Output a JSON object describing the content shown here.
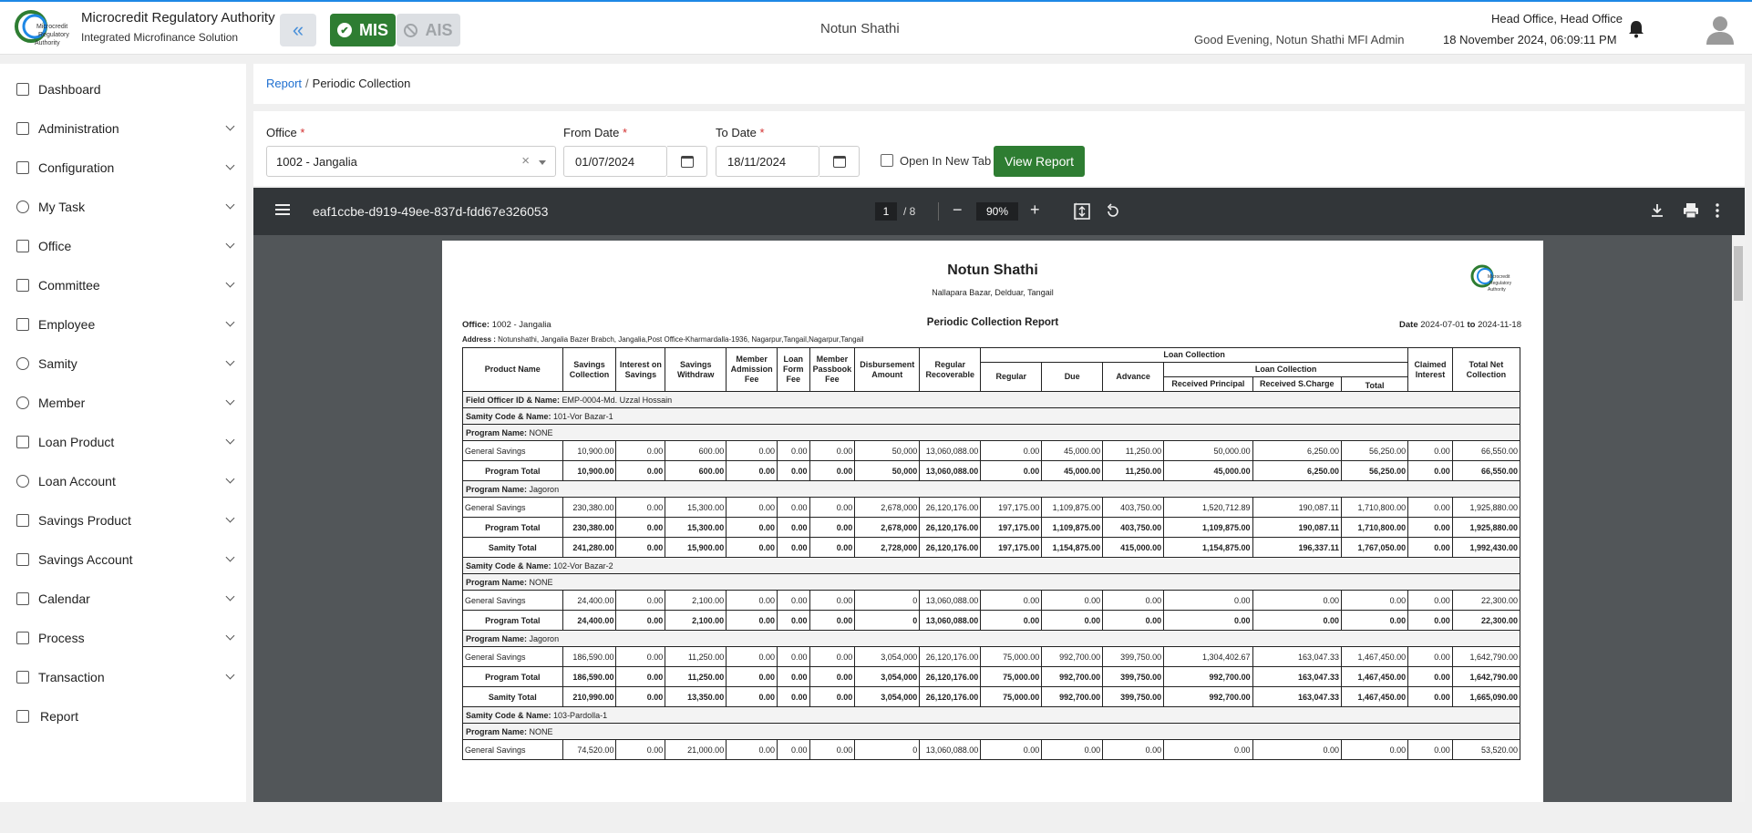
{
  "app": {
    "org_name": "Microcredit Regulatory Authority",
    "org_sub": "Integrated Microfinance Solution",
    "mis_label": "MIS",
    "ais_label": "AIS",
    "center_title": "Notun Shathi",
    "greeting": "Good Evening, Notun Shathi MFI Admin",
    "branch": "Head Office, Head Office",
    "datetime": "18 November 2024, 06:09:11 PM",
    "logo_text": "Microcredit Regulatory Authority"
  },
  "sidebar": {
    "items": [
      {
        "label": "Dashboard",
        "icon": "dashboard-icon"
      },
      {
        "label": "Administration",
        "icon": "admin-icon"
      },
      {
        "label": "Configuration",
        "icon": "sliders-icon"
      },
      {
        "label": "My Task",
        "icon": "task-icon"
      },
      {
        "label": "Office",
        "icon": "office-icon"
      },
      {
        "label": "Committee",
        "icon": "committee-icon"
      },
      {
        "label": "Employee",
        "icon": "employee-icon"
      },
      {
        "label": "Samity",
        "icon": "samity-icon"
      },
      {
        "label": "Member",
        "icon": "member-icon"
      },
      {
        "label": "Loan Product",
        "icon": "loan-product-icon"
      },
      {
        "label": "Loan Account",
        "icon": "loan-account-icon"
      },
      {
        "label": "Savings Product",
        "icon": "savings-product-icon"
      },
      {
        "label": "Savings Account",
        "icon": "savings-account-icon"
      },
      {
        "label": "Calendar",
        "icon": "calendar-icon"
      },
      {
        "label": "Process",
        "icon": "process-icon"
      },
      {
        "label": "Transaction",
        "icon": "transaction-icon"
      },
      {
        "label": "Report",
        "icon": "report-icon"
      }
    ]
  },
  "breadcrumb": {
    "root": "Report",
    "sep": "/",
    "current": "Periodic Collection"
  },
  "filters": {
    "office_label": "Office",
    "office_value": "1002 - Jangalia",
    "from_label": "From Date",
    "from_value": "01/07/2024",
    "to_label": "To Date",
    "to_value": "18/11/2024",
    "req": "*",
    "open_new_tab": "Open In New Tab",
    "view_report": "View Report"
  },
  "pdf": {
    "file_name": "eaf1ccbe-d919-49ee-837d-fdd67e326053",
    "page": "1",
    "page_total": "/ 8",
    "zoom": "90%"
  },
  "report": {
    "title": "Notun Shathi",
    "address_line": "Nallapara Bazar, Delduar, Tangail",
    "heading": "Periodic Collection Report",
    "office_label": "Office:",
    "office_value": "1002 - Jangalia",
    "address_label": "Address :",
    "address_value": "Notunshathi, Jangalia Bazer Brabch, Jangalia,Post Office-Kharmardalla-1936, Nagarpur,Tangail,Nagarpur,Tangail",
    "date_label": "Date",
    "date_from": "2024-07-01",
    "date_to_word": "to",
    "date_to": "2024-11-18",
    "headers": {
      "product_name": "Product Name",
      "savings_collection": "Savings Collection",
      "interest_on_savings": "Interest on Savings",
      "savings_withdraw": "Savings Withdraw",
      "member_admission_fee": "Member Admission Fee",
      "loan_form_fee": "Loan Form Fee",
      "member_passbook_fee": "Member Passbook Fee",
      "disbursement_amount": "Disbursement Amount",
      "regular_recoverable": "Regular Recoverable",
      "loan_collection": "Loan Collection",
      "regular": "Regular",
      "due": "Due",
      "advance": "Advance",
      "loan_collection_sub": "Loan Collection",
      "received_principal": "Received Principal",
      "received_scharge": "Received S.Charge",
      "total": "Total",
      "claimed_interest": "Claimed Interest",
      "total_net_collection": "Total Net Collection"
    },
    "rows": [
      {
        "kind": "sec",
        "label": "Field Officer ID & Name:",
        "value": "EMP-0004-Md. Uzzal Hossain"
      },
      {
        "kind": "sec",
        "label": "Samity Code & Name:",
        "value": "101-Vor Bazar-1"
      },
      {
        "kind": "sec",
        "label": "Program Name:",
        "value": "NONE"
      },
      {
        "kind": "data",
        "cells": [
          "General Savings",
          "10,900.00",
          "0.00",
          "600.00",
          "0.00",
          "0.00",
          "0.00",
          "50,000",
          "13,060,088.00",
          "0.00",
          "45,000.00",
          "11,250.00",
          "50,000.00",
          "6,250.00",
          "56,250.00",
          "0.00",
          "66,550.00"
        ]
      },
      {
        "kind": "tot",
        "cells": [
          "Program Total",
          "10,900.00",
          "0.00",
          "600.00",
          "0.00",
          "0.00",
          "0.00",
          "50,000",
          "13,060,088.00",
          "0.00",
          "45,000.00",
          "11,250.00",
          "45,000.00",
          "6,250.00",
          "56,250.00",
          "0.00",
          "66,550.00"
        ]
      },
      {
        "kind": "sec",
        "label": "Program Name:",
        "value": "Jagoron"
      },
      {
        "kind": "data",
        "cells": [
          "General Savings",
          "230,380.00",
          "0.00",
          "15,300.00",
          "0.00",
          "0.00",
          "0.00",
          "2,678,000",
          "26,120,176.00",
          "197,175.00",
          "1,109,875.00",
          "403,750.00",
          "1,520,712.89",
          "190,087.11",
          "1,710,800.00",
          "0.00",
          "1,925,880.00"
        ]
      },
      {
        "kind": "tot",
        "cells": [
          "Program Total",
          "230,380.00",
          "0.00",
          "15,300.00",
          "0.00",
          "0.00",
          "0.00",
          "2,678,000",
          "26,120,176.00",
          "197,175.00",
          "1,109,875.00",
          "403,750.00",
          "1,109,875.00",
          "190,087.11",
          "1,710,800.00",
          "0.00",
          "1,925,880.00"
        ]
      },
      {
        "kind": "tot",
        "cells": [
          "Samity Total",
          "241,280.00",
          "0.00",
          "15,900.00",
          "0.00",
          "0.00",
          "0.00",
          "2,728,000",
          "26,120,176.00",
          "197,175.00",
          "1,154,875.00",
          "415,000.00",
          "1,154,875.00",
          "196,337.11",
          "1,767,050.00",
          "0.00",
          "1,992,430.00"
        ]
      },
      {
        "kind": "sec",
        "label": "Samity Code & Name:",
        "value": "102-Vor Bazar-2"
      },
      {
        "kind": "sec",
        "label": "Program Name:",
        "value": "NONE"
      },
      {
        "kind": "data",
        "cells": [
          "General Savings",
          "24,400.00",
          "0.00",
          "2,100.00",
          "0.00",
          "0.00",
          "0.00",
          "0",
          "13,060,088.00",
          "0.00",
          "0.00",
          "0.00",
          "0.00",
          "0.00",
          "0.00",
          "0.00",
          "22,300.00"
        ]
      },
      {
        "kind": "tot",
        "cells": [
          "Program Total",
          "24,400.00",
          "0.00",
          "2,100.00",
          "0.00",
          "0.00",
          "0.00",
          "0",
          "13,060,088.00",
          "0.00",
          "0.00",
          "0.00",
          "0.00",
          "0.00",
          "0.00",
          "0.00",
          "22,300.00"
        ]
      },
      {
        "kind": "sec",
        "label": "Program Name:",
        "value": "Jagoron"
      },
      {
        "kind": "data",
        "cells": [
          "General Savings",
          "186,590.00",
          "0.00",
          "11,250.00",
          "0.00",
          "0.00",
          "0.00",
          "3,054,000",
          "26,120,176.00",
          "75,000.00",
          "992,700.00",
          "399,750.00",
          "1,304,402.67",
          "163,047.33",
          "1,467,450.00",
          "0.00",
          "1,642,790.00"
        ]
      },
      {
        "kind": "tot",
        "cells": [
          "Program Total",
          "186,590.00",
          "0.00",
          "11,250.00",
          "0.00",
          "0.00",
          "0.00",
          "3,054,000",
          "26,120,176.00",
          "75,000.00",
          "992,700.00",
          "399,750.00",
          "992,700.00",
          "163,047.33",
          "1,467,450.00",
          "0.00",
          "1,642,790.00"
        ]
      },
      {
        "kind": "tot",
        "cells": [
          "Samity Total",
          "210,990.00",
          "0.00",
          "13,350.00",
          "0.00",
          "0.00",
          "0.00",
          "3,054,000",
          "26,120,176.00",
          "75,000.00",
          "992,700.00",
          "399,750.00",
          "992,700.00",
          "163,047.33",
          "1,467,450.00",
          "0.00",
          "1,665,090.00"
        ]
      },
      {
        "kind": "sec",
        "label": "Samity Code & Name:",
        "value": "103-Pardolla-1"
      },
      {
        "kind": "sec",
        "label": "Program Name:",
        "value": "NONE"
      },
      {
        "kind": "data",
        "cells": [
          "General Savings",
          "74,520.00",
          "0.00",
          "21,000.00",
          "0.00",
          "0.00",
          "0.00",
          "0",
          "13,060,088.00",
          "0.00",
          "0.00",
          "0.00",
          "0.00",
          "0.00",
          "0.00",
          "0.00",
          "53,520.00"
        ]
      }
    ]
  }
}
